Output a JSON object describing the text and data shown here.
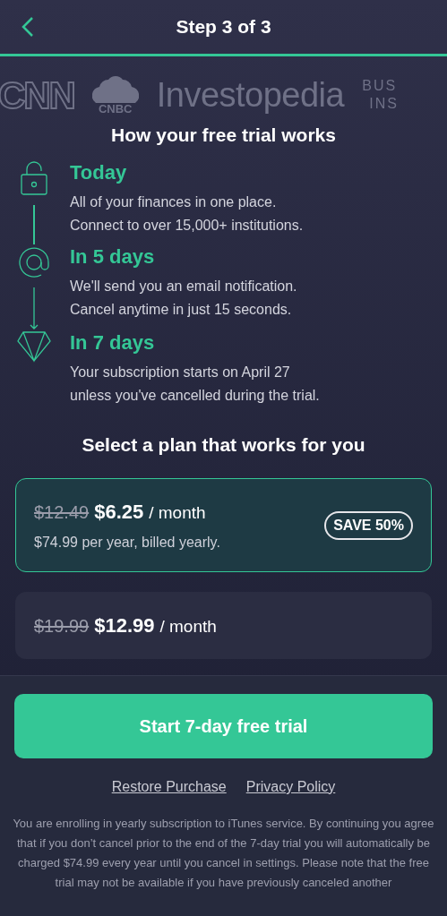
{
  "header": {
    "title": "Step 3 of 3"
  },
  "progress": {
    "level": 1
  },
  "logos": [
    {
      "kind": "outline",
      "text": "CNN"
    },
    {
      "kind": "peacock",
      "text": "CNBC"
    },
    {
      "kind": "word",
      "text": "Investopedia"
    },
    {
      "kind": "stacked",
      "lines": [
        "BUS",
        "INS"
      ]
    }
  ],
  "timeline": {
    "title": "How your free trial works",
    "steps": [
      {
        "kind": "lock",
        "title": "Today",
        "lines": [
          "All of your finances in one place.",
          "Connect to over 15,000+ institutions."
        ]
      },
      {
        "kind": "at",
        "title": "In 5 days",
        "lines": [
          "We'll send you an email notification.",
          "Cancel anytime in just 15 seconds."
        ]
      },
      {
        "kind": "gem",
        "title": "In 7 days",
        "lines": [
          "Your subscription starts on April 27",
          "unless you've cancelled during the trial."
        ]
      }
    ]
  },
  "plans": {
    "title": "Select a plan that works for you",
    "items": [
      {
        "old_price": "$12.49",
        "price": "$6.25",
        "period": "/ month",
        "note": "$74.99 per year, billed yearly.",
        "badge": "SAVE 50%",
        "selected": true
      },
      {
        "old_price": "$19.99",
        "price": "$12.99",
        "period": "/ month",
        "selected": false
      }
    ]
  },
  "footer": {
    "button": "Start 7-day free trial",
    "links": [
      "Restore Purchase",
      "Privacy Policy"
    ],
    "legal": "You are enrolling in yearly subscription to iTunes service. By continuing you agree that if you don’t cancel prior to the end of the 7-day trial you will automatically be charged $74.99 every year until you cancel in settings. Please note that the free trial may not be available if you have previously canceled another"
  }
}
